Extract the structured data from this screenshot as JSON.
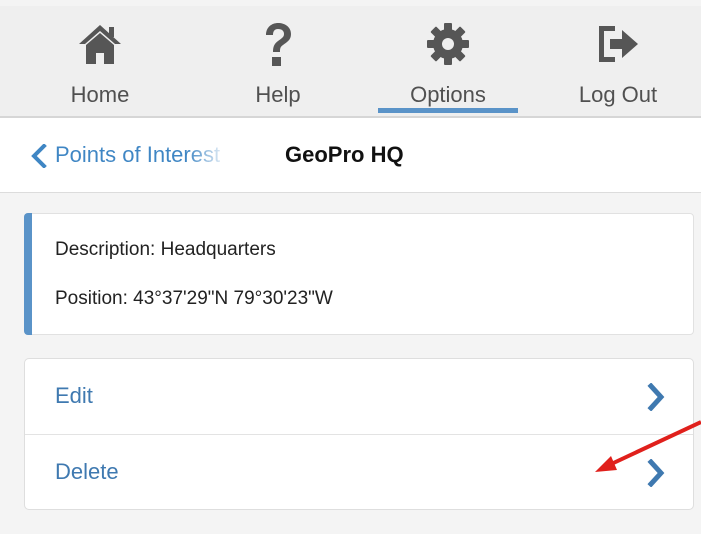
{
  "nav": {
    "items": [
      {
        "label": "Home",
        "icon": "home-icon"
      },
      {
        "label": "Help",
        "icon": "question-icon"
      },
      {
        "label": "Options",
        "icon": "gear-icon",
        "active": true
      },
      {
        "label": "Log Out",
        "icon": "logout-icon"
      }
    ]
  },
  "breadcrumb": {
    "back_label": "Points of Interest",
    "title": "GeoPro HQ"
  },
  "details": {
    "description": "Description: Headquarters",
    "position": "Position: 43°37'29\"N 79°30'23\"W"
  },
  "actions": [
    {
      "label": "Edit"
    },
    {
      "label": "Delete"
    }
  ],
  "colors": {
    "accent": "#5a93c8",
    "link": "#3f86c4",
    "annotation_arrow": "#e0201c"
  }
}
